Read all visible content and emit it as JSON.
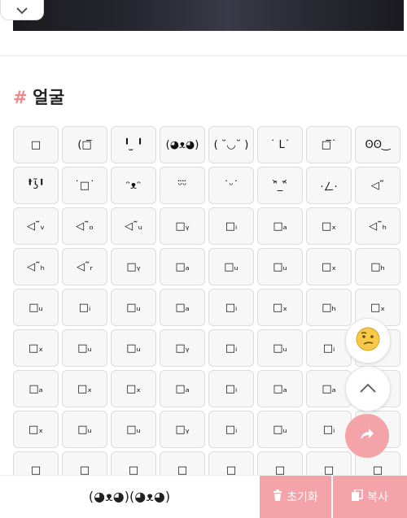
{
  "section": {
    "hash": "#",
    "title": "얼굴"
  },
  "faces": [
    "□",
    "(□̅",
    "╹ ̫ ╹",
    "(◕ᴥ◕)",
    "( ˘◡˘ )",
    "˙ L˙",
    "□̅˙",
    "ʘʘ‿",
    "╹̃ʖ̃╹",
    "˙□˙",
    "ᵔᴥᵔ",
    "ᵕ̈ᵕ̈",
    "˙ᵕ˙",
    "ᵔ᷅_ᵔ᷄",
    "·ㄥ·",
    "◁˜",
    "◁˜ᵥ",
    "◁˜ₒ",
    "◁˜ᵤ",
    "□ᵧ",
    "□ᵢ",
    "□ₐ",
    "□ₓ",
    "◁˜ₕ",
    "◁˜ₕ",
    "◁˜ᵣ",
    "□ᵧ",
    "□ₐ",
    "□ᵤ",
    "□ᵤ",
    "□ₓ",
    "□ₕ",
    "□ᵤ",
    "□ᵢ",
    "□ᵤ",
    "□ₐ",
    "□ᵢ",
    "□ₓ",
    "□ₕ",
    "□ₓ",
    "□ₓ",
    "□ᵤ",
    "□ᵤ",
    "□ᵧ",
    "□ᵢ",
    "□ᵤ",
    "□ᵢ",
    "□ₓ",
    "□ₐ",
    "□ₓ",
    "□ₓ",
    "□ₐ",
    "□ᵢ",
    "□ₐ",
    "□ₐ",
    "□ᵢ",
    "□ₓ",
    "□ᵤ",
    "□ᵤ",
    "□ᵧ",
    "□ᵢ",
    "□ᵤ",
    "□ᵢ",
    "□ₓ",
    "□",
    "□",
    "□",
    "□",
    "□",
    "□",
    "□",
    "□"
  ],
  "bottom": {
    "preview": "(◕ᴥ◕)(◕ᴥ◕)",
    "reset_label": "초기화",
    "copy_label": "복사"
  },
  "colors": {
    "accent": "#f4a4a8",
    "hash": "#f08a8a"
  }
}
